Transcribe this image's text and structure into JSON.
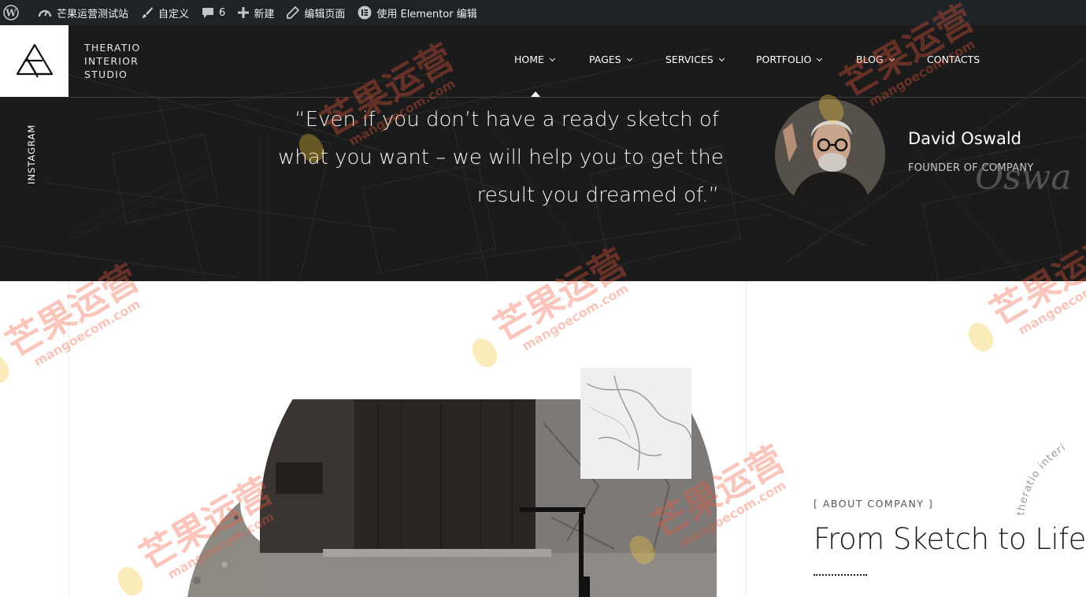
{
  "adminbar": {
    "site_name": "芒果运营测试站",
    "customize": "自定义",
    "comments_count": "6",
    "new": "新建",
    "edit_page": "编辑页面",
    "elementor": "使用 Elementor 编辑"
  },
  "brand": {
    "line1": "THERATIO",
    "line2": "INTERIOR",
    "line3": "STUDIO"
  },
  "nav": [
    {
      "label": "HOME",
      "dropdown": true,
      "active": true
    },
    {
      "label": "PAGES",
      "dropdown": true
    },
    {
      "label": "SERVICES",
      "dropdown": true
    },
    {
      "label": "PORTFOLIO",
      "dropdown": true
    },
    {
      "label": "BLOG",
      "dropdown": true
    },
    {
      "label": "CONTACTS",
      "dropdown": false
    }
  ],
  "social": {
    "instagram": "INSTAGRAM"
  },
  "testimonial": {
    "line1": "“Even if you don’t have a ready sketch of",
    "line2": "what you want – we will help you to get the",
    "line3": "result you dreamed of.”",
    "author": "David Oswald",
    "role": "FOUNDER OF COMPANY",
    "signature": "Oswa"
  },
  "about": {
    "label": "[ ABOUT COMPANY ]",
    "title": "From Sketch to Life",
    "curved_text": "theratio interi"
  },
  "watermark": {
    "cn": "芒果运营",
    "en": "mangoecom.com"
  },
  "colors": {
    "adminbar_bg": "#1d2327",
    "hero_bg": "#1b1b1b",
    "text_dark": "#1b1b1b"
  }
}
